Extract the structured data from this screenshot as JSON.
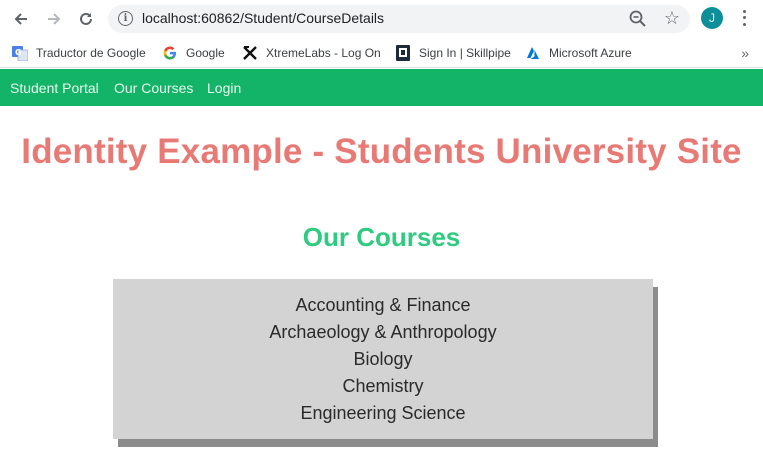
{
  "browser": {
    "url": "localhost:60862/Student/CourseDetails",
    "avatar_initial": "J",
    "nav_icons": [
      "back-arrow-icon",
      "forward-arrow-icon",
      "reload-icon"
    ],
    "bookmarks": [
      {
        "label": "Traductor de Google",
        "icon": "google-translate-icon",
        "color": "#4a7fe8"
      },
      {
        "label": "Google",
        "icon": "google-icon",
        "color": "#4285f4"
      },
      {
        "label": "XtremeLabs - Log On",
        "icon": "xtremelabs-icon",
        "color": "#111111"
      },
      {
        "label": "Sign In | Skillpipe",
        "icon": "skillpipe-icon",
        "color": "#1b2b3a"
      },
      {
        "label": "Microsoft Azure",
        "icon": "azure-icon",
        "color": "#0078d4"
      }
    ],
    "bookmarks_overflow": "»"
  },
  "navbar": {
    "color": "#13b467",
    "links": [
      "Student Portal",
      "Our Courses",
      "Login"
    ]
  },
  "page": {
    "title": "Identity Example - Students University Site",
    "title_color": "#e87a76",
    "heading": "Our Courses",
    "heading_color": "#2ecc80",
    "courses": [
      "Accounting & Finance",
      "Archaeology & Anthropology",
      "Biology",
      "Chemistry",
      "Engineering Science"
    ]
  }
}
